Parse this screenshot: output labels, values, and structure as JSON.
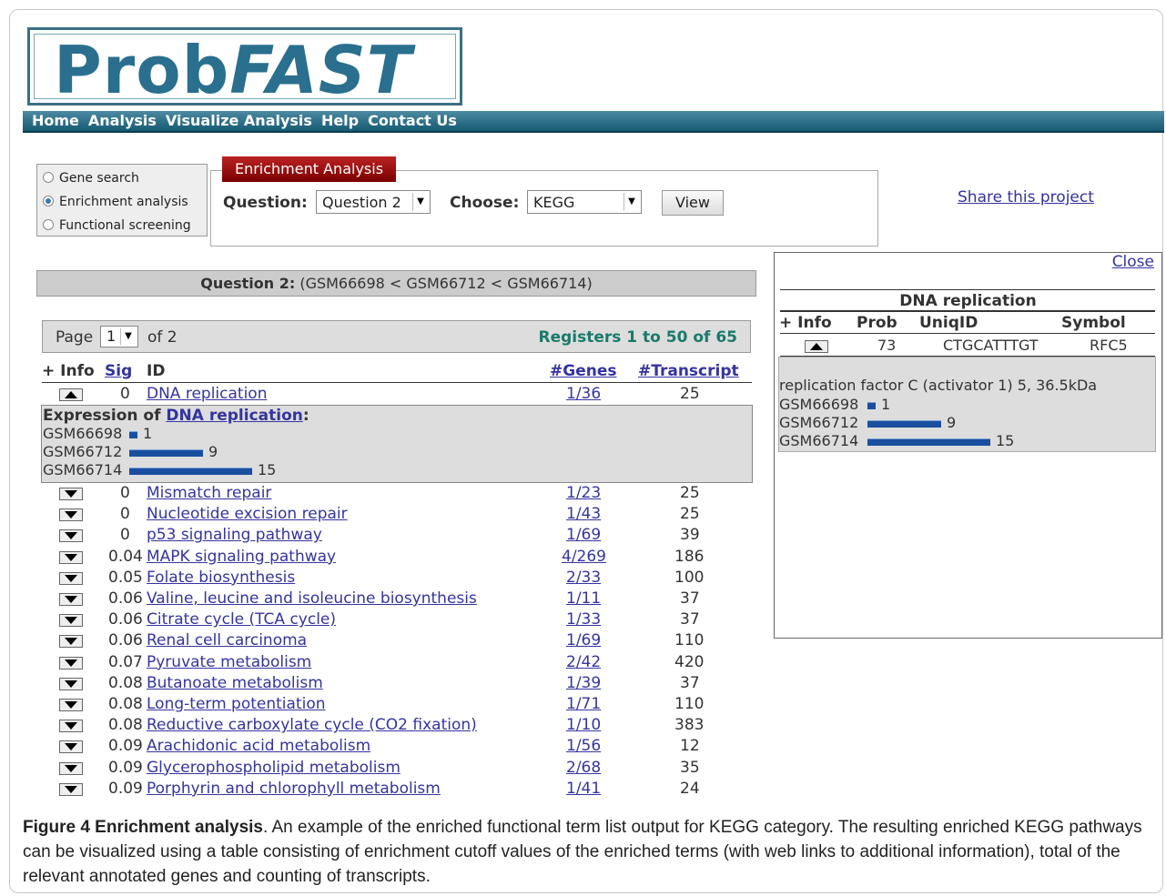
{
  "logo": {
    "part1": "Prob",
    "part2": "FAST"
  },
  "nav": [
    "Home",
    "Analysis",
    "Visualize Analysis",
    "Help",
    "Contact Us"
  ],
  "radios": [
    {
      "label": "Gene search",
      "checked": false
    },
    {
      "label": "Enrichment analysis",
      "checked": true
    },
    {
      "label": "Functional screening",
      "checked": false
    }
  ],
  "enrichment": {
    "tab": "Enrichment Analysis",
    "question_label": "Question:",
    "question_value": "Question 2",
    "choose_label": "Choose:",
    "choose_value": "KEGG",
    "view_button": "View"
  },
  "share_link": "Share this project",
  "question_bar": {
    "bold": "Question 2:",
    "text": "(GSM66698 < GSM66712 < GSM66714)"
  },
  "pager": {
    "page_label": "Page",
    "page_value": "1",
    "of_text": "of 2",
    "registers": "Registers 1 to 50 of 65"
  },
  "table_headers": {
    "info": "+ Info",
    "sig": "Sig",
    "id": "ID",
    "genes": "#Genes",
    "transcript": "#Transcript"
  },
  "first_row": {
    "sig": "0",
    "id": "DNA replication",
    "genes": "1/36",
    "transcript": "25"
  },
  "expression": {
    "title_prefix": "Expression of ",
    "title_link": "DNA replication",
    "title_suffix": ":",
    "rows": [
      {
        "sample": "GSM66698",
        "value": 1
      },
      {
        "sample": "GSM66712",
        "value": 9
      },
      {
        "sample": "GSM66714",
        "value": 15
      }
    ]
  },
  "rows": [
    {
      "sig": "0",
      "id": "Mismatch repair",
      "genes": "1/23",
      "transcript": "25"
    },
    {
      "sig": "0",
      "id": "Nucleotide excision repair",
      "genes": "1/43",
      "transcript": "25"
    },
    {
      "sig": "0",
      "id": "p53 signaling pathway",
      "genes": "1/69",
      "transcript": "39"
    },
    {
      "sig": "0.04",
      "id": "MAPK signaling pathway",
      "genes": "4/269",
      "transcript": "186"
    },
    {
      "sig": "0.05",
      "id": "Folate biosynthesis",
      "genes": "2/33",
      "transcript": "100"
    },
    {
      "sig": "0.06",
      "id": "Valine, leucine and isoleucine biosynthesis",
      "genes": "1/11",
      "transcript": "37"
    },
    {
      "sig": "0.06",
      "id": "Citrate cycle (TCA cycle)",
      "genes": "1/33",
      "transcript": "37"
    },
    {
      "sig": "0.06",
      "id": "Renal cell carcinoma",
      "genes": "1/69",
      "transcript": "110"
    },
    {
      "sig": "0.07",
      "id": "Pyruvate metabolism",
      "genes": "2/42",
      "transcript": "420"
    },
    {
      "sig": "0.08",
      "id": "Butanoate metabolism",
      "genes": "1/39",
      "transcript": "37"
    },
    {
      "sig": "0.08",
      "id": "Long-term potentiation",
      "genes": "1/71",
      "transcript": "110"
    },
    {
      "sig": "0.08",
      "id": "Reductive carboxylate cycle (CO2 fixation)",
      "genes": "1/10",
      "transcript": "383"
    },
    {
      "sig": "0.09",
      "id": "Arachidonic acid metabolism",
      "genes": "1/56",
      "transcript": "12"
    },
    {
      "sig": "0.09",
      "id": "Glycerophospholipid metabolism",
      "genes": "2/68",
      "transcript": "35"
    },
    {
      "sig": "0.09",
      "id": "Porphyrin and chlorophyll metabolism",
      "genes": "1/41",
      "transcript": "24"
    }
  ],
  "side_panel": {
    "close": "Close",
    "title": "DNA replication",
    "headers": {
      "info": "+ Info",
      "prob": "Prob",
      "uniqid": "UniqID",
      "symbol": "Symbol"
    },
    "row": {
      "prob": "73",
      "uniqid": "CTGCATTTGT",
      "symbol": "RFC5"
    },
    "description": "replication factor C (activator 1) 5, 36.5kDa",
    "expression": [
      {
        "sample": "GSM66698",
        "value": 1
      },
      {
        "sample": "GSM66712",
        "value": 9
      },
      {
        "sample": "GSM66714",
        "value": 15
      }
    ]
  },
  "caption": {
    "bold": "Figure 4 Enrichment analysis",
    "text": ". An example of the enriched functional term list output for KEGG category. The resulting enriched KEGG pathways can be visualized using a table consisting of enrichment cutoff values of the enriched terms (with web links to additional information), total of the relevant annotated genes and counting of transcripts."
  }
}
